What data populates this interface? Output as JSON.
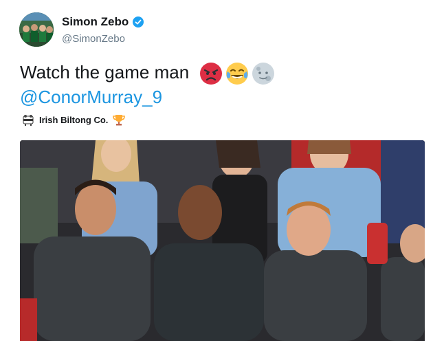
{
  "tweet": {
    "author": {
      "display_name": "Simon Zebo",
      "handle": "@SimonZebo",
      "verified": true,
      "avatar_icon": "team-photo-avatar"
    },
    "text": "Watch the game man",
    "emojis": [
      "angry-face-icon",
      "tears-of-joy-icon",
      "moon-face-icon"
    ],
    "mention": "@ConorMurray_9",
    "sponsor": {
      "label": "Irish Biltong Co.",
      "logo_icon": "biltong-logo-icon",
      "trophy_icon": "trophy-icon"
    },
    "media": {
      "description_icon": "crowd-video-frame"
    }
  },
  "colors": {
    "link": "#1b95e0",
    "text": "#14171a",
    "secondary": "#657786",
    "verified": "#1da1f2"
  }
}
